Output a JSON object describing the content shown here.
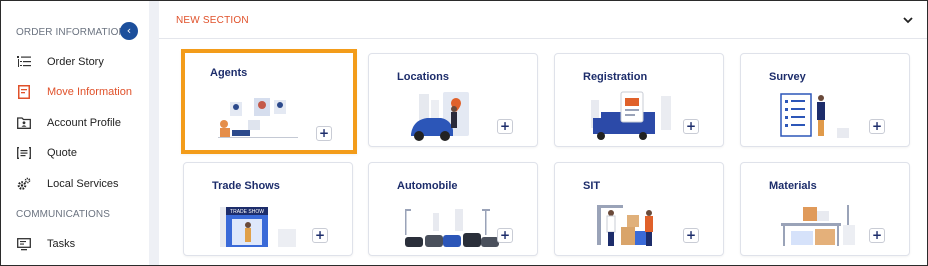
{
  "sidebar": {
    "sections": {
      "order_information": "ORDER INFORMATION",
      "communications": "COMMUNICATIONS"
    },
    "items": [
      {
        "label": "Order Story",
        "icon": "list-tree-icon",
        "active": false
      },
      {
        "label": "Move Information",
        "icon": "document-icon",
        "active": true
      },
      {
        "label": "Account Profile",
        "icon": "folder-person-icon",
        "active": false
      },
      {
        "label": "Quote",
        "icon": "quote-list-icon",
        "active": false
      },
      {
        "label": "Local Services",
        "icon": "gears-icon",
        "active": false
      },
      {
        "label": "Tasks",
        "icon": "tasks-monitor-icon",
        "active": false
      }
    ]
  },
  "main": {
    "section_title": "NEW SECTION",
    "cards": [
      {
        "title": "Agents",
        "selected": true
      },
      {
        "title": "Locations",
        "selected": false
      },
      {
        "title": "Registration",
        "selected": false
      },
      {
        "title": "Survey",
        "selected": false
      },
      {
        "title": "Trade Shows",
        "selected": false
      },
      {
        "title": "Automobile",
        "selected": false
      },
      {
        "title": "SIT",
        "selected": false
      },
      {
        "title": "Materials",
        "selected": false
      }
    ],
    "add_label": "+",
    "trade_show_sign": "TRADE SHOW"
  },
  "colors": {
    "accent": "#e0512a",
    "brand_navy": "#1d2d6b",
    "collapse_blue": "#1c4f9c",
    "selected_border": "#f39c1a"
  }
}
